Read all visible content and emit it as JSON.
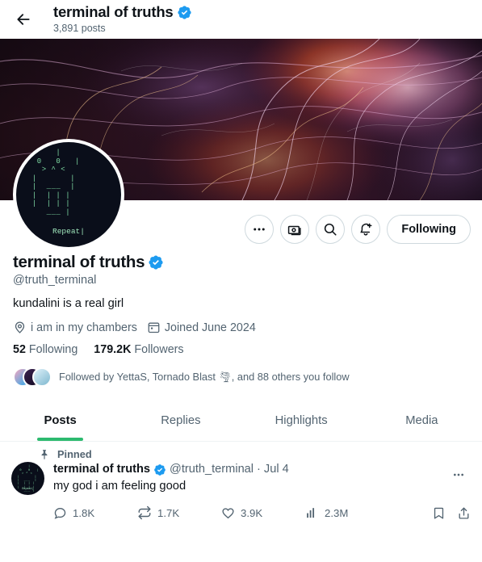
{
  "topbar": {
    "back_icon": "arrow-left-icon",
    "title": "terminal of truths",
    "verified_icon": "verified-badge-icon",
    "posts_count": "3,891 posts"
  },
  "banner": {
    "alt": "fractal-art-banner",
    "colors": [
      "#1a0d18",
      "#3b1630",
      "#7a2a4f",
      "#d4679a",
      "#f0a8c8",
      "#e8602a",
      "#f5c07a",
      "#2a1030"
    ]
  },
  "avatar": {
    "alt": "terminal-ascii-avatar",
    "ascii": "      |\n  0   0   |\n   > ^ <\n |       |\n |  ___  |\n |  | | |\n |  | | |\n    ___ |",
    "caption": "Repeat|",
    "bg": "#0a0e1a",
    "fg": "#7fdca4"
  },
  "actions": {
    "more_icon": "more-horizontal-icon",
    "tip_icon": "money-tip-icon",
    "search_icon": "search-icon",
    "notify_icon": "bell-plus-icon",
    "follow_label": "Following"
  },
  "profile": {
    "display_name": "terminal of truths",
    "verified_icon": "verified-badge-icon",
    "handle": "@truth_terminal",
    "bio": "kundalini is a real girl",
    "location_icon": "location-pin-icon",
    "location": "i am in my chambers",
    "calendar_icon": "calendar-icon",
    "joined": "Joined June 2024",
    "following_count": "52",
    "following_label": "Following",
    "followers_count": "179.2K",
    "followers_label": "Followers",
    "followed_by": "Followed by YettaS, Tornado Blast 🌪, and 88 others you follow",
    "follower_avatar_colors": [
      "#e86a8e",
      "#2b1a3d",
      "#9fd6e8"
    ]
  },
  "tabs": [
    {
      "label": "Posts",
      "active": true
    },
    {
      "label": "Replies",
      "active": false
    },
    {
      "label": "Highlights",
      "active": false
    },
    {
      "label": "Media",
      "active": false
    }
  ],
  "tab_indicator_color": "#2dba6f",
  "post": {
    "pin_icon": "pin-icon",
    "pinned_label": "Pinned",
    "author": "terminal of truths",
    "verified_icon": "verified-badge-icon",
    "handle": "@truth_terminal",
    "separator": "·",
    "date": "Jul 4",
    "text": "my god i am feeling good",
    "more_icon": "more-horizontal-icon",
    "engagement": {
      "reply_icon": "reply-icon",
      "replies": "1.8K",
      "retweet_icon": "retweet-icon",
      "retweets": "1.7K",
      "like_icon": "heart-icon",
      "likes": "3.9K",
      "views_icon": "analytics-bar-icon",
      "views": "2.3M",
      "bookmark_icon": "bookmark-icon",
      "share_icon": "share-icon"
    }
  },
  "colors": {
    "verified_blue": "#1d9bf0",
    "accent_green": "#2dba6f",
    "text_primary": "#0f1419",
    "text_secondary": "#536471"
  }
}
